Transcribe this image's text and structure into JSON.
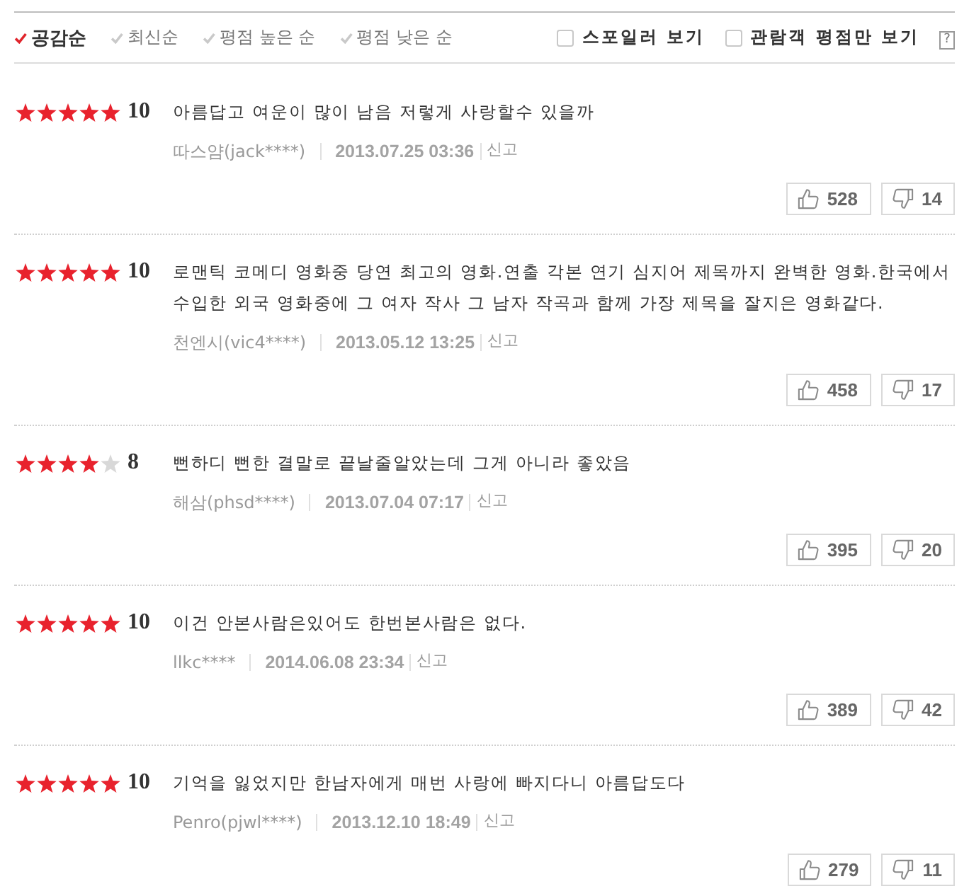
{
  "sort_options": [
    {
      "label": "공감순",
      "selected": true
    },
    {
      "label": "최신순",
      "selected": false
    },
    {
      "label": "평점 높은 순",
      "selected": false
    },
    {
      "label": "평점 낮은 순",
      "selected": false
    }
  ],
  "filters": [
    {
      "label": "스포일러 보기",
      "checked": false
    },
    {
      "label": "관람객 평점만 보기",
      "checked": false
    }
  ],
  "help": "?",
  "reviews": [
    {
      "stars": 5,
      "score": "10",
      "text": "아름답고 여운이 많이 남음 저렇게 사랑할수 있을까",
      "author": "따스얌(jack****)",
      "date": "2013.07.25 03:36",
      "report": "신고",
      "likes": "528",
      "dislikes": "14"
    },
    {
      "stars": 5,
      "score": "10",
      "text": "로맨틱 코메디 영화중 당연 최고의 영화.연출 각본 연기 심지어 제목까지 완벽한 영화.한국에서 수입한 외국 영화중에 그 여자 작사 그 남자 작곡과 함께 가장 제목을 잘지은 영화같다.",
      "author": "천엔시(vic4****)",
      "date": "2013.05.12 13:25",
      "report": "신고",
      "likes": "458",
      "dislikes": "17"
    },
    {
      "stars": 4,
      "score": "8",
      "text": "뻔하디 뻔한 결말로 끝날줄알았는데 그게 아니라 좋았음",
      "author": "해삼(phsd****)",
      "date": "2013.07.04 07:17",
      "report": "신고",
      "likes": "395",
      "dislikes": "20"
    },
    {
      "stars": 5,
      "score": "10",
      "text": "이건 안본사람은있어도 한번본사람은 없다.",
      "author": "llkc****",
      "date": "2014.06.08 23:34",
      "report": "신고",
      "likes": "389",
      "dislikes": "42"
    },
    {
      "stars": 5,
      "score": "10",
      "text": "기억을 잃었지만 한남자에게 매번 사랑에 빠지다니 아름답도다",
      "author": "Penro(pjwl****)",
      "date": "2013.12.10 18:49",
      "report": "신고",
      "likes": "279",
      "dislikes": "11"
    }
  ]
}
